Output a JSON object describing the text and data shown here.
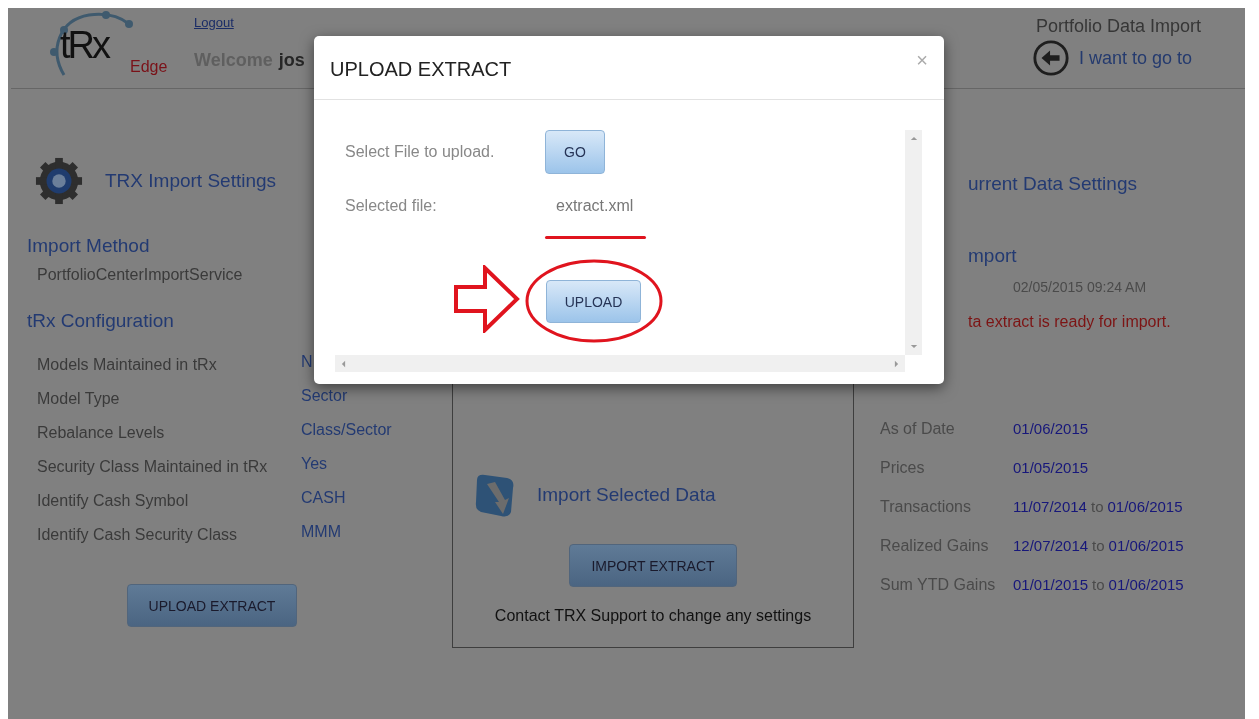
{
  "header": {
    "logo": {
      "main": "tRx",
      "sub": "Edge"
    },
    "logout": "Logout",
    "welcome": "Welcome",
    "user": "jos",
    "page_title": "Portfolio Data Import",
    "nav_link": "I want to go to"
  },
  "import_settings": {
    "title": "TRX Import Settings",
    "method_heading": "Import Method",
    "method": "PortfolioCenterImportService",
    "config_heading": "tRx Configuration",
    "rows": [
      {
        "label": "Models Maintained in tRx",
        "value": "N"
      },
      {
        "label": "Model Type",
        "value": "Sector"
      },
      {
        "label": "Rebalance Levels",
        "value": "Class/Sector"
      },
      {
        "label": "Security Class Maintained in tRx",
        "value": "Yes"
      },
      {
        "label": "Identify Cash Symbol",
        "value": "CASH"
      },
      {
        "label": "Identify Cash Security Class",
        "value": "MMM"
      }
    ],
    "button": "UPLOAD EXTRACT"
  },
  "import_panel": {
    "title": "Import Selected Data",
    "button": "IMPORT EXTRACT",
    "note": "Contact TRX Support to change any settings"
  },
  "current_data": {
    "title": "urrent Data Settings",
    "last_heading": "mport",
    "last_time": "02/05/2015 09:24 AM",
    "status": "ta extract is ready for import.",
    "rows": [
      {
        "label": "As of Date",
        "from": "01/06/2015"
      },
      {
        "label": "Prices",
        "from": "01/05/2015"
      },
      {
        "label": "Transactions",
        "from": "11/07/2014",
        "sep": "to",
        "to": "01/06/2015"
      },
      {
        "label": "Realized Gains",
        "from": "12/07/2014",
        "sep": "to",
        "to": "01/06/2015"
      },
      {
        "label": "Sum YTD Gains",
        "from": "01/01/2015",
        "sep": "to",
        "to": "01/06/2015"
      }
    ]
  },
  "modal": {
    "title": "UPLOAD EXTRACT",
    "close": "×",
    "select_label": "Select File to upload.",
    "go_button": "GO",
    "file_label": "Selected file:",
    "file_name": "extract.xml",
    "upload_button": "UPLOAD"
  }
}
